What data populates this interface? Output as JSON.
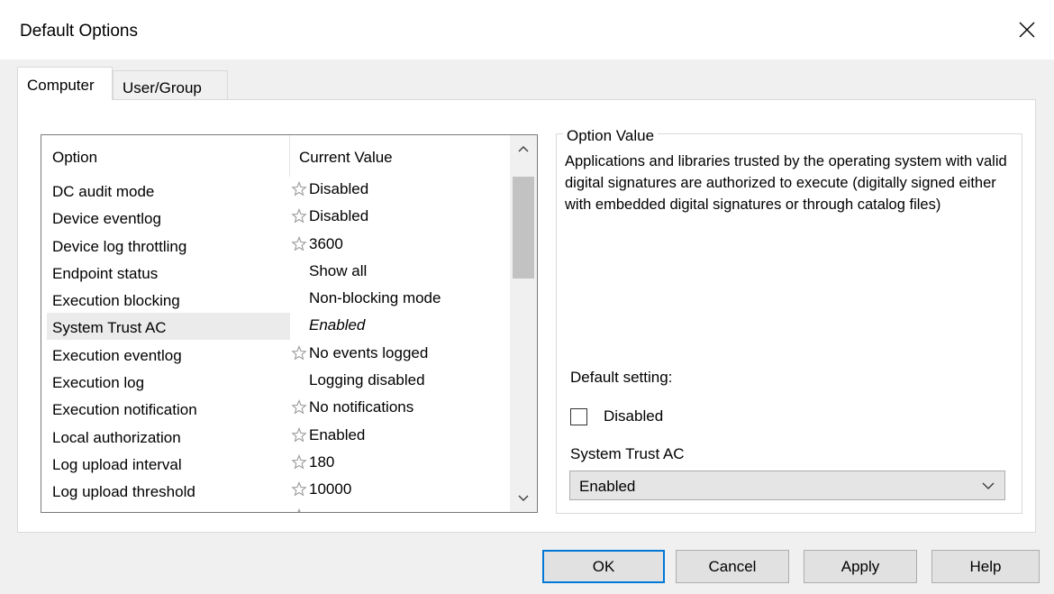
{
  "window": {
    "title": "Default Options"
  },
  "tabs": [
    {
      "label": "Computer",
      "active": true
    },
    {
      "label": "User/Group",
      "active": false
    }
  ],
  "list": {
    "headers": {
      "option": "Option",
      "value": "Current Value"
    },
    "rows": [
      {
        "option": "DC audit mode",
        "value": "Disabled",
        "star": true,
        "italic": false,
        "selected": false
      },
      {
        "option": "Device eventlog",
        "value": "Disabled",
        "star": true,
        "italic": false,
        "selected": false
      },
      {
        "option": "Device log throttling",
        "value": "3600",
        "star": true,
        "italic": false,
        "selected": false
      },
      {
        "option": "Endpoint status",
        "value": "Show all",
        "star": false,
        "italic": false,
        "selected": false
      },
      {
        "option": "Execution blocking",
        "value": "Non-blocking mode",
        "star": false,
        "italic": false,
        "selected": false
      },
      {
        "option": "System Trust AC",
        "value": "Enabled",
        "star": false,
        "italic": true,
        "selected": true
      },
      {
        "option": "Execution eventlog",
        "value": "No events logged",
        "star": true,
        "italic": false,
        "selected": false
      },
      {
        "option": "Execution log",
        "value": "Logging disabled",
        "star": false,
        "italic": false,
        "selected": false
      },
      {
        "option": "Execution notification",
        "value": "No notifications",
        "star": true,
        "italic": false,
        "selected": false
      },
      {
        "option": "Local authorization",
        "value": "Enabled",
        "star": true,
        "italic": false,
        "selected": false
      },
      {
        "option": "Log upload interval",
        "value": "180",
        "star": true,
        "italic": false,
        "selected": false
      },
      {
        "option": "Log upload threshold",
        "value": "10000",
        "star": true,
        "italic": false,
        "selected": false
      },
      {
        "option": "",
        "value": "",
        "star": true,
        "italic": false,
        "selected": false
      }
    ]
  },
  "option_value": {
    "legend": "Option Value",
    "description": "Applications and libraries trusted by the operating system with valid digital signatures are authorized to execute (digitally signed either with embedded digital signatures or through catalog files)",
    "default_setting_label": "Default setting:",
    "checkbox_label": "Disabled",
    "checkbox_checked": false,
    "select_label": "System Trust AC",
    "select_value": "Enabled"
  },
  "buttons": {
    "ok": "OK",
    "cancel": "Cancel",
    "apply": "Apply",
    "help": "Help"
  },
  "icons": {
    "close": "close-icon",
    "star": "star-icon",
    "up": "chevron-up-icon",
    "down": "chevron-down-icon"
  },
  "colors": {
    "accent": "#0078d7",
    "selection": "#ebebeb"
  }
}
